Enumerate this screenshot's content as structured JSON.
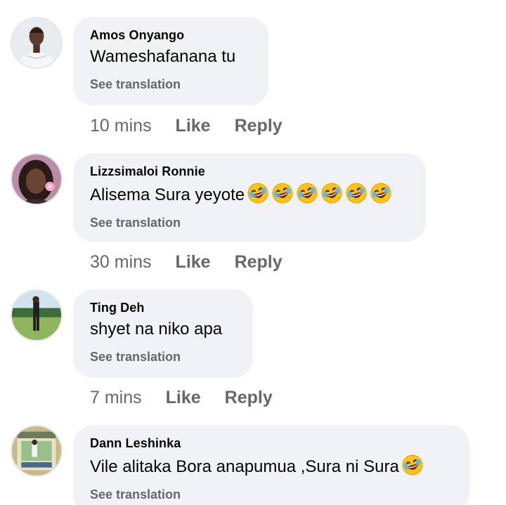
{
  "comments": [
    {
      "author": "Amos Onyango",
      "text": "Wameshafanana tu",
      "emoji_count": 0,
      "translate_label": "See translation",
      "time": "10 mins",
      "like_label": "Like",
      "reply_label": "Reply"
    },
    {
      "author": "Lizzsimaloi Ronnie",
      "text": "Alisema Sura yeyote",
      "emoji_count": 6,
      "translate_label": "See translation",
      "time": "30 mins",
      "like_label": "Like",
      "reply_label": "Reply"
    },
    {
      "author": "Ting Deh",
      "text": "shyet na niko apa",
      "emoji_count": 0,
      "translate_label": "See translation",
      "time": "7 mins",
      "like_label": "Like",
      "reply_label": "Reply"
    },
    {
      "author": "Dann Leshinka",
      "text": "Vile alitaka Bora anapumua ,Sura ni Sura",
      "emoji_count": 1,
      "translate_label": "See translation"
    }
  ],
  "emoji_icon": "rolling-on-floor-laughing-icon",
  "colors": {
    "bubble": "#f0f2f5",
    "muted_text": "#65676b",
    "text": "#050505"
  }
}
